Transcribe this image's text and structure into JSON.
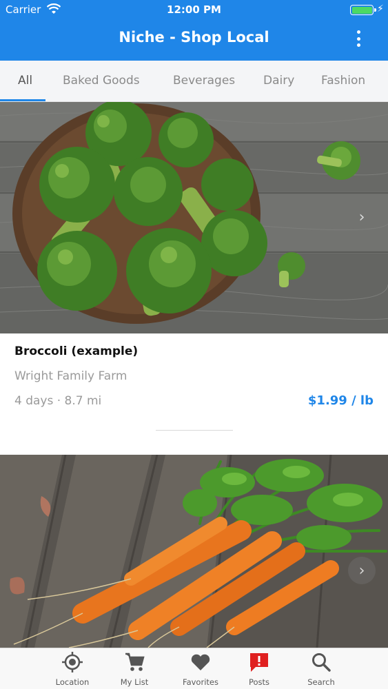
{
  "status_bar": {
    "carrier": "Carrier",
    "time": "12:00 PM"
  },
  "header": {
    "title": "Niche - Shop Local",
    "menu_icon": "more-vertical-icon"
  },
  "colors": {
    "primary": "#1f86e8",
    "price": "#1f86e8",
    "battery": "#4cd964",
    "alert_badge": "#e02020"
  },
  "categories": [
    {
      "label": "All",
      "active": true
    },
    {
      "label": "Baked Goods"
    },
    {
      "label": "Beverages"
    },
    {
      "label": "Dairy"
    },
    {
      "label": "Fashion"
    }
  ],
  "products": [
    {
      "name": "Broccoli (example)",
      "seller": "Wright Family Farm",
      "meta": "4 days · 8.7 mi",
      "price": "$1.99 / lb"
    }
  ],
  "tabbar": [
    {
      "label": "Location",
      "icon": "location-target-icon"
    },
    {
      "label": "My List",
      "icon": "shopping-cart-icon"
    },
    {
      "label": "Favorites",
      "icon": "heart-icon"
    },
    {
      "label": "Posts",
      "icon": "alert-chat-icon"
    },
    {
      "label": "Search",
      "icon": "search-icon"
    }
  ]
}
